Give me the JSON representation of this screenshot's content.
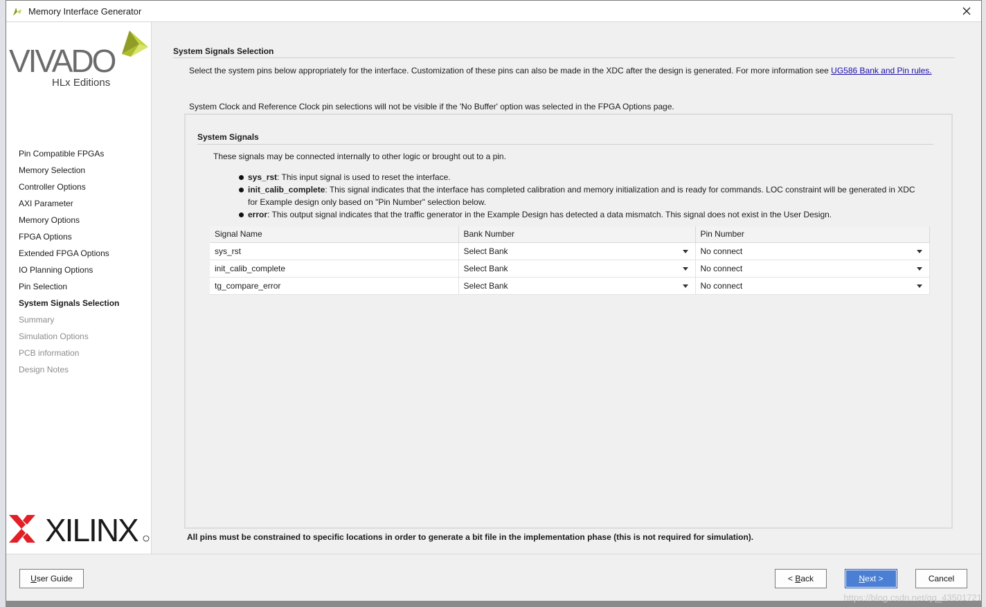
{
  "window": {
    "title": "Memory Interface Generator"
  },
  "sidebar": {
    "vivado_logo": "VIVADO",
    "vivado_sub": "HLx Editions",
    "xilinx_logo": "XILINX",
    "items": [
      {
        "label": "Pin Compatible FPGAs",
        "state": "normal"
      },
      {
        "label": "Memory Selection",
        "state": "normal"
      },
      {
        "label": "Controller Options",
        "state": "normal"
      },
      {
        "label": "AXI Parameter",
        "state": "normal"
      },
      {
        "label": "Memory Options",
        "state": "normal"
      },
      {
        "label": "FPGA Options",
        "state": "normal"
      },
      {
        "label": "Extended FPGA Options",
        "state": "normal"
      },
      {
        "label": "IO Planning Options",
        "state": "normal"
      },
      {
        "label": "Pin Selection",
        "state": "normal"
      },
      {
        "label": "System Signals Selection",
        "state": "active"
      },
      {
        "label": "Summary",
        "state": "disabled"
      },
      {
        "label": "Simulation Options",
        "state": "disabled"
      },
      {
        "label": "PCB information",
        "state": "disabled"
      },
      {
        "label": "Design Notes",
        "state": "disabled"
      }
    ]
  },
  "main": {
    "section_title": "System Signals Selection",
    "intro_text": "Select the system pins below appropriately for the interface. Customization of these pins can also be made in the XDC after the design is generated. For more information see ",
    "intro_link": "UG586 Bank and Pin rules.",
    "intro_note": "System Clock and Reference Clock pin selections will not be visible if the 'No Buffer' option was selected in the FPGA Options page.",
    "panel": {
      "title": "System Signals",
      "description": "These signals may be connected internally to other logic or brought out to a pin.",
      "bullets": [
        {
          "term": "sys_rst",
          "text": ": This input signal is used to reset the interface."
        },
        {
          "term": "init_calib_complete",
          "text": ": This signal indicates that the interface has completed calibration and memory initialization and is ready for commands. LOC constraint will be generated in XDC for Example design only based on \"Pin Number\" selection below."
        },
        {
          "term": "error",
          "text": ": This output signal indicates that the traffic generator in the Example Design has detected a data mismatch. This signal does not exist in the User Design."
        }
      ],
      "table": {
        "headers": [
          "Signal Name",
          "Bank Number",
          "Pin Number"
        ],
        "rows": [
          {
            "signal": "sys_rst",
            "bank": "Select Bank",
            "pin": "No connect"
          },
          {
            "signal": "init_calib_complete",
            "bank": "Select Bank",
            "pin": "No connect"
          },
          {
            "signal": "tg_compare_error",
            "bank": "Select Bank",
            "pin": "No connect"
          }
        ]
      }
    },
    "footer_note": "All pins must be constrained to specific locations in order to generate a bit file in the implementation phase (this is not required for simulation)."
  },
  "buttons": {
    "user_guide": {
      "underline": "U",
      "rest": "ser Guide"
    },
    "back": {
      "pre": "< ",
      "underline": "B",
      "rest": "ack"
    },
    "next": {
      "underline": "N",
      "rest": "ext >"
    },
    "cancel": "Cancel"
  },
  "watermark": "https://blog.csdn.net/qq_43501721",
  "colors": {
    "accent_next": "#4a7fd4",
    "vivado_leaf": "#b3c33a",
    "xilinx_red": "#e21f26",
    "link": "#1a0dab"
  }
}
